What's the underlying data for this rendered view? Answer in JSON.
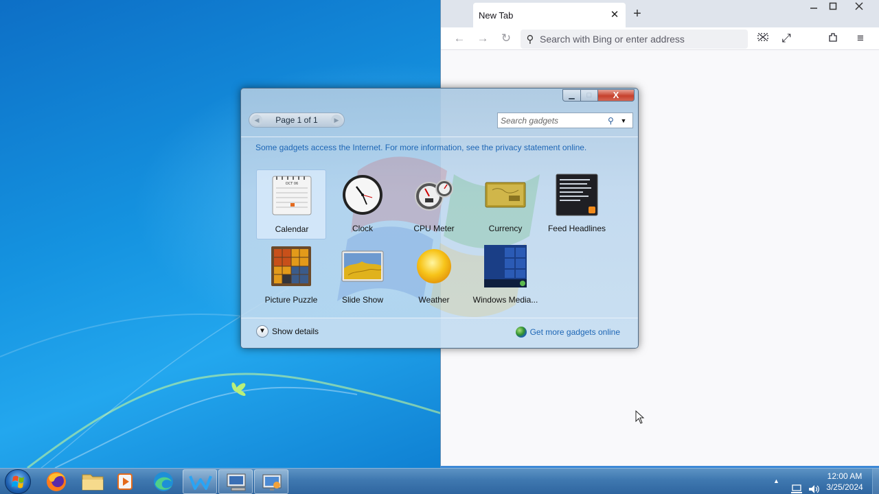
{
  "browser": {
    "tab_title": "New Tab",
    "tab_close": "✕",
    "new_tab": "+",
    "window_controls": {
      "minimize": "—",
      "maximize": "☐",
      "close": "✕"
    },
    "url_placeholder": "Search with Bing or enter address",
    "icons": [
      "back-icon",
      "forward-icon",
      "reload-icon",
      "search-icon",
      "screenshot-icon",
      "fullscreen-icon",
      "extensions-icon",
      "menu-icon"
    ]
  },
  "gadgets": {
    "pager_label": "Page 1 of 1",
    "search_placeholder": "Search gadgets",
    "info_text": "Some gadgets access the Internet.  For more information, see the privacy statement online.",
    "items": [
      {
        "label": "Calendar",
        "icon": "calendar-icon",
        "selected": true
      },
      {
        "label": "Clock",
        "icon": "clock-icon"
      },
      {
        "label": "CPU Meter",
        "icon": "cpu-meter-icon"
      },
      {
        "label": "Currency",
        "icon": "currency-icon"
      },
      {
        "label": "Feed Headlines",
        "icon": "feed-headlines-icon"
      },
      {
        "label": "Picture Puzzle",
        "icon": "picture-puzzle-icon"
      },
      {
        "label": "Slide Show",
        "icon": "slide-show-icon"
      },
      {
        "label": "Weather",
        "icon": "weather-icon"
      },
      {
        "label": "Windows Media...",
        "icon": "windows-media-icon"
      }
    ],
    "calendar_month": "OCT 06",
    "show_details": "Show details",
    "more_online": "Get more gadgets online",
    "controls": {
      "minimize": "▁",
      "maximize": "□",
      "close": "X"
    }
  },
  "taskbar": {
    "apps": [
      "firefox-icon",
      "file-explorer-icon",
      "media-player-icon",
      "edge-icon",
      "wps-icon",
      "remote-desktop-icon",
      "display-settings-icon"
    ],
    "tray": {
      "overflow": "▲",
      "network": "network-icon",
      "volume": "volume-icon"
    },
    "time": "12:00 AM",
    "date": "3/25/2024"
  },
  "colors": {
    "desktop_blue": "#1593e0",
    "taskbar": "#3f78b0",
    "gadget_link": "#1d66b5",
    "close_red": "#c6412c"
  }
}
